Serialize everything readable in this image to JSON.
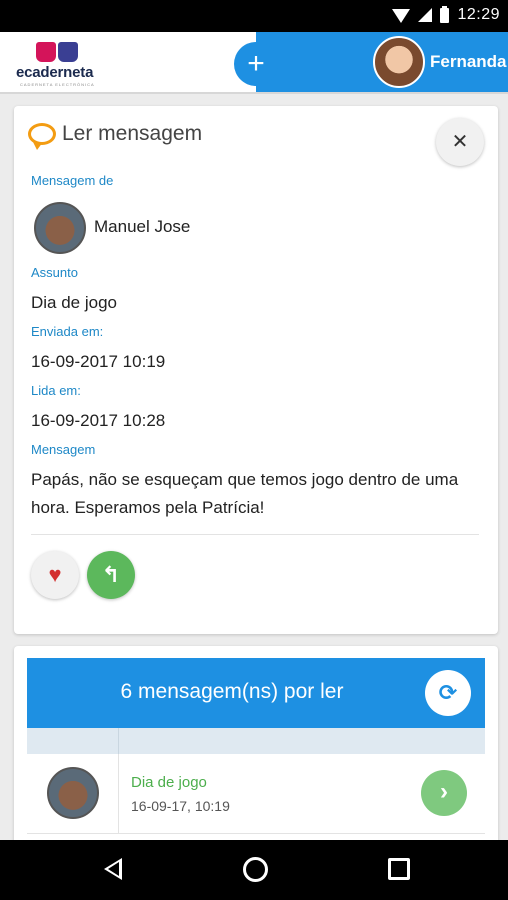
{
  "status_bar": {
    "time": "12:29"
  },
  "header": {
    "logo_text": "ecaderneta",
    "logo_subtitle": "CADERNETA ELECTRÓNICA",
    "add_label": "+",
    "user_name": "Fernanda"
  },
  "message": {
    "title": "Ler mensagem",
    "close_label": "✕",
    "from_label": "Mensagem de",
    "sender_name": "Manuel Jose",
    "subject_label": "Assunto",
    "subject": "Dia de jogo",
    "sent_label": "Enviada em:",
    "sent_at": "16-09-2017 10:19",
    "read_label": "Lida em:",
    "read_at": "16-09-2017 10:28",
    "body_label": "Mensagem",
    "body": "Papás, não se esqueçam que temos jogo dentro de uma hora. Esperamos pela Patrícia!",
    "like_label": "♥",
    "reply_label": "↰"
  },
  "unread": {
    "title": "6 mensagem(ns) por ler",
    "refresh_label": "⟳",
    "rows": [
      {
        "subject": "Dia de jogo",
        "date": "16-09-17, 10:19",
        "open_label": "›"
      }
    ]
  },
  "colors": {
    "accent_blue": "#1e90e2",
    "label_blue": "#1e88c7",
    "green": "#5cb85c",
    "heart_red": "#d32f2f",
    "bubble_orange": "#f39c12"
  },
  "icons": [
    "wifi-icon",
    "signal-icon",
    "battery-icon",
    "speech-bubble-icon",
    "close-icon",
    "heart-icon",
    "reply-icon",
    "refresh-icon",
    "chevron-right-icon",
    "back-icon",
    "home-icon",
    "recent-apps-icon"
  ]
}
